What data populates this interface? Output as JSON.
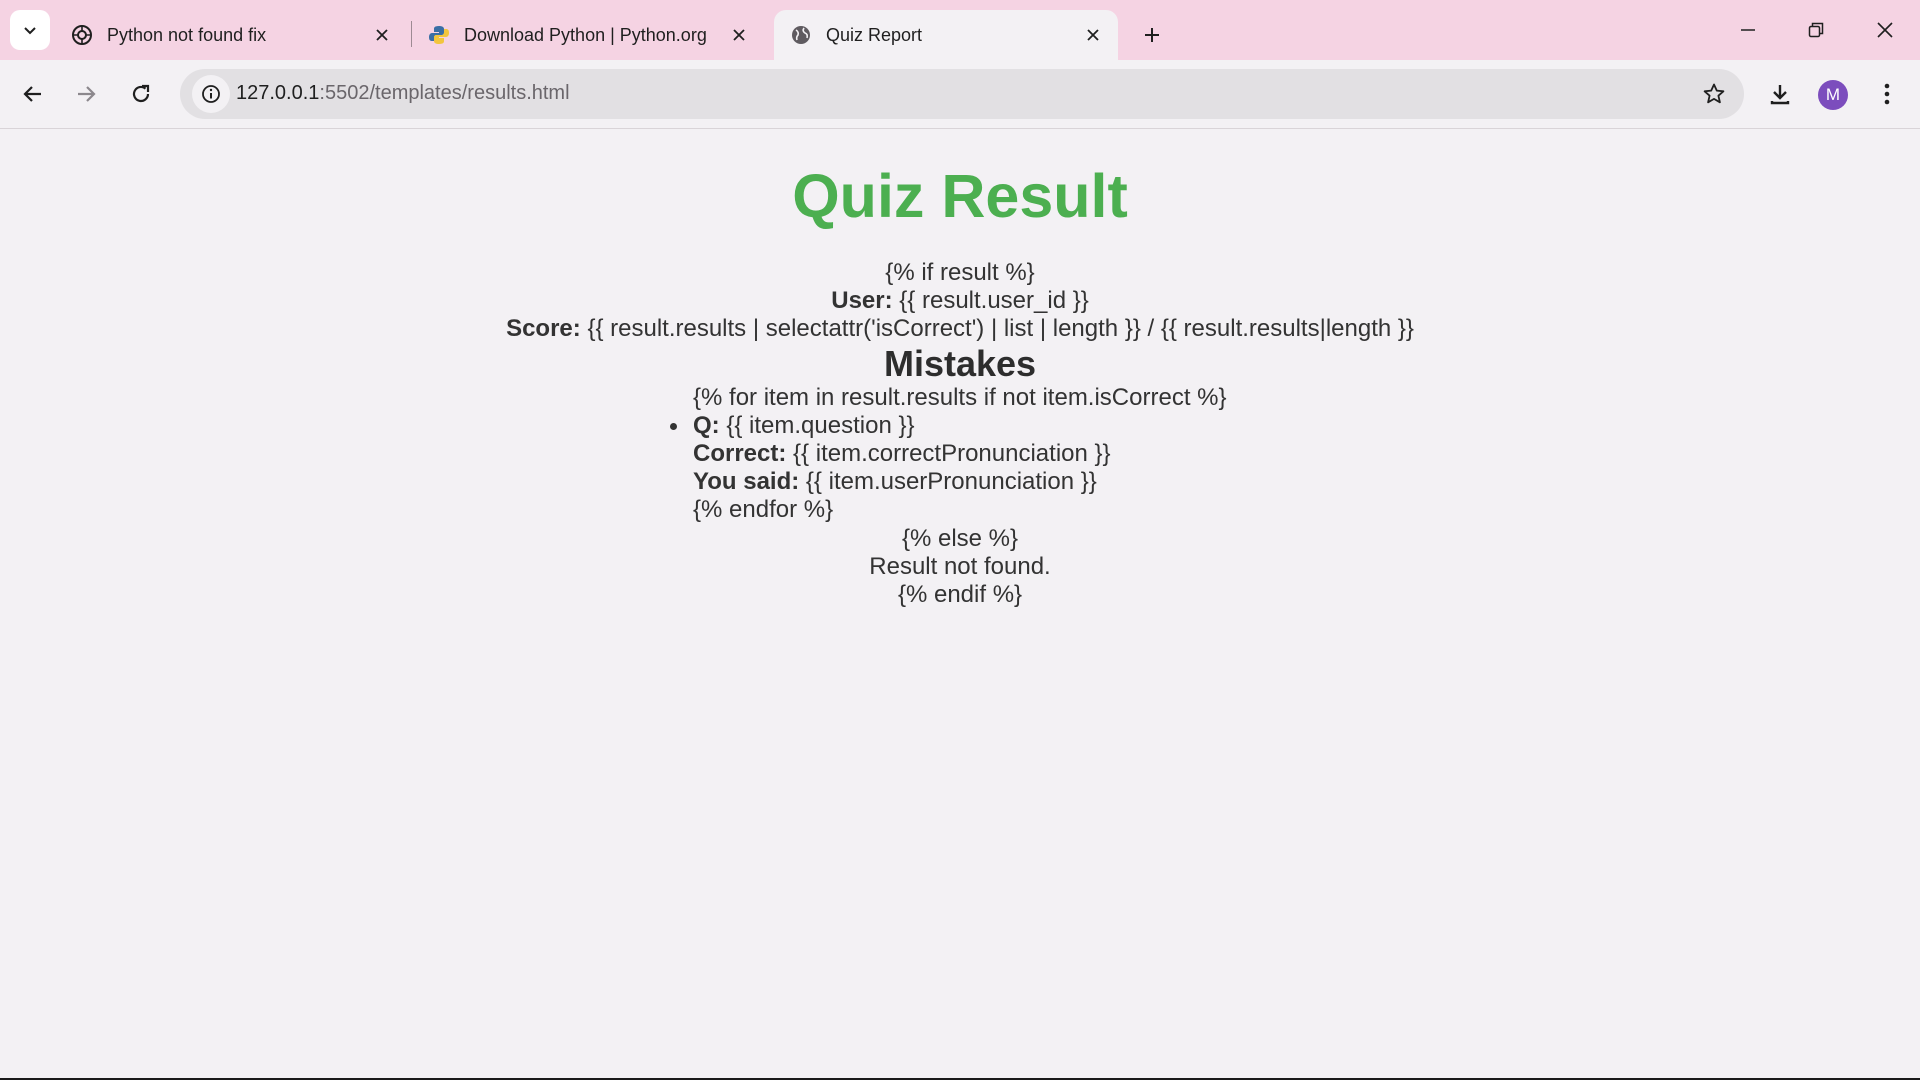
{
  "browser": {
    "tabs": [
      {
        "title": "Python not found fix",
        "icon": "openai-icon",
        "active": false
      },
      {
        "title": "Download Python | Python.org",
        "icon": "python-icon",
        "active": false
      },
      {
        "title": "Quiz Report",
        "icon": "globe-icon",
        "active": true
      }
    ],
    "address": {
      "host": "127.0.0.1",
      "path": ":5502/templates/results.html"
    },
    "profile_initial": "M",
    "colors": {
      "tabstrip": "#f5d3e3",
      "toolbar": "#f3f1f4",
      "avatar": "#7c4dbd"
    }
  },
  "page": {
    "title": "Quiz Result",
    "title_color": "#4caf50",
    "if_open": "{% if result %}",
    "user_label": "User:",
    "user_value": "{{ result.user_id }}",
    "score_label": "Score:",
    "score_value": "{{ result.results | selectattr('isCorrect') | list | length }} / {{ result.results|length }}",
    "mistakes_heading": "Mistakes",
    "for_open": "{% for item in result.results if not item.isCorrect %}",
    "q_label": "Q:",
    "q_value": "{{ item.question }}",
    "correct_label": "Correct:",
    "correct_value": "{{ item.correctPronunciation }}",
    "said_label": "You said:",
    "said_value": "{{ item.userPronunciation }}",
    "for_close": "{% endfor %}",
    "else_tag": "{% else %}",
    "not_found": "Result not found.",
    "endif_tag": "{% endif %}"
  }
}
